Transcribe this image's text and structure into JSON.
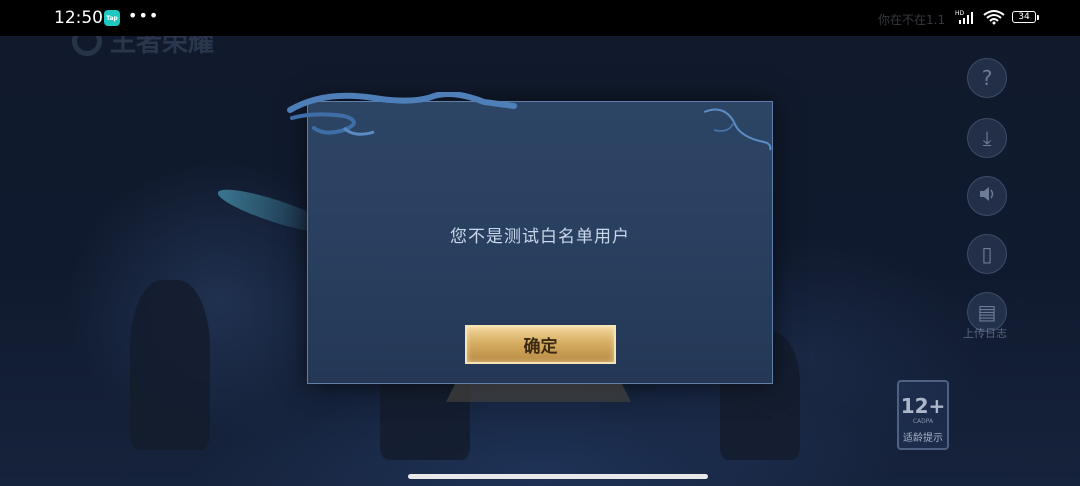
{
  "status_bar": {
    "time": "12:50",
    "app_icon_label": "Tap",
    "more_icon": "more-dots-icon",
    "ghost_text": "你在不在1.1",
    "network_label": "HD",
    "battery": "34"
  },
  "background": {
    "logo_text": "王者荣耀"
  },
  "side_buttons": [
    {
      "icon": "help-icon",
      "glyph": "?"
    },
    {
      "icon": "download-icon",
      "glyph": "⤓"
    },
    {
      "icon": "volume-icon",
      "glyph": "🔊"
    },
    {
      "icon": "phone-icon",
      "glyph": "▯"
    },
    {
      "icon": "upload-log-icon",
      "glyph": "▤"
    }
  ],
  "side_label": "上传日志",
  "age_badge": {
    "rating": "12+",
    "org": "CADPA",
    "tip": "适龄提示"
  },
  "dialog": {
    "message": "您不是测试白名单用户",
    "confirm_label": "确定"
  },
  "colors": {
    "dialog_bg": "#2d4565",
    "dialog_border": "#5f7ea8",
    "button_gold": "#d6ad62",
    "message_text": "#c9d7ea"
  }
}
